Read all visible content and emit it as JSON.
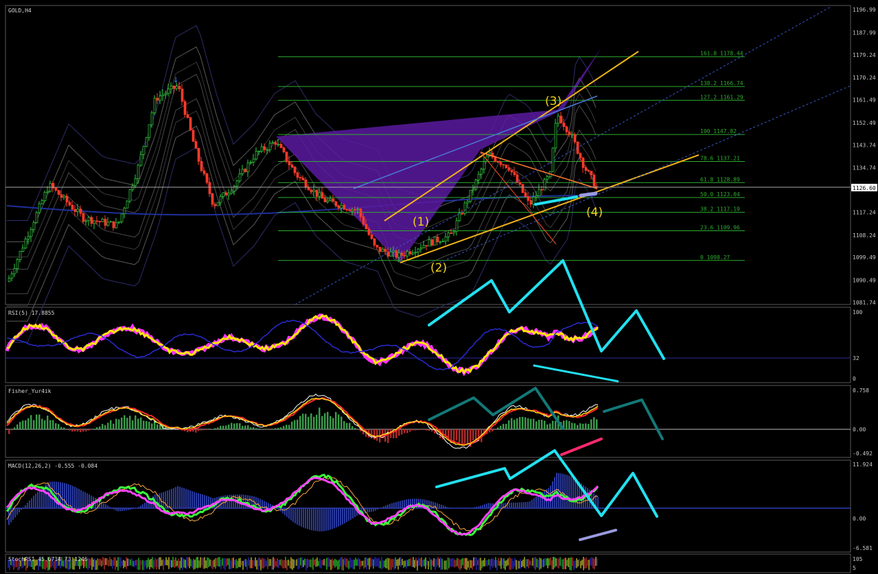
{
  "colors": {
    "background": "#000000",
    "axis": "#c8c8c8",
    "fib": "#2fae2f",
    "harmonic_fill": "#5a1aa0",
    "wave_label": "#f2d21b",
    "arrow_cyan": "#22e0f0",
    "arrow_teal": "#137878",
    "arrow_pink": "#ff2a6d",
    "arrow_lavender": "#9a9ae0",
    "rsi_line": "#ffe400",
    "macd_line": "#ff44ff",
    "macd_hist": "#2a3aa0"
  },
  "main_panel": {
    "title": "GOLD,H4",
    "current_price": "1126.60",
    "price_axis": [
      "1196.99",
      "1187.99",
      "1179.24",
      "1170.24",
      "1161.49",
      "1152.49",
      "1143.74",
      "1134.74",
      "1117.24",
      "1108.24",
      "1099.49",
      "1090.49",
      "1081.74"
    ],
    "fib_levels": [
      {
        "label": "161.8",
        "value": "1178.44"
      },
      {
        "label": "138.2",
        "value": "1166.74"
      },
      {
        "label": "127.2",
        "value": "1161.29"
      },
      {
        "label": "100",
        "value": "1147.82"
      },
      {
        "label": "78.6",
        "value": "1137.21"
      },
      {
        "label": "61.8",
        "value": "1128.89"
      },
      {
        "label": "50.0",
        "value": "1123.04"
      },
      {
        "label": "38.2",
        "value": "1117.19"
      },
      {
        "label": "23.6",
        "value": "1109.96"
      },
      {
        "label": "0",
        "value": "1098.27"
      }
    ],
    "wave_labels": [
      "(1)",
      "(2)",
      "(3)",
      "(4)"
    ]
  },
  "rsi_panel": {
    "title": "RSI(5) 17.8855",
    "axis": [
      "100",
      "32",
      "0"
    ]
  },
  "fisher_panel": {
    "title": "Fisher_Yur4ik",
    "axis": [
      "0.758",
      "0.00",
      "-0.492"
    ]
  },
  "macd_panel": {
    "title": "MACD(12,26,2) -0.555 -0.084",
    "axis": [
      "11.924",
      "0.00",
      "-6.581"
    ]
  },
  "stoch_panel": {
    "title": "StochRSI 45.6714 73.1246",
    "axis": [
      "105",
      "5"
    ]
  }
}
